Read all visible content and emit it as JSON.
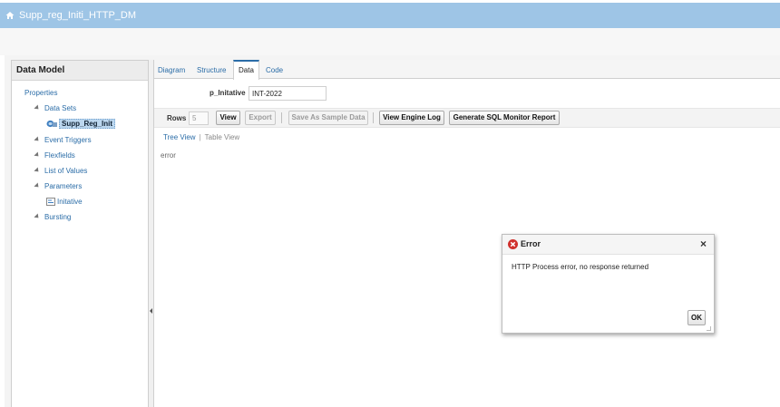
{
  "header": {
    "title": "Supp_reg_Initi_HTTP_DM",
    "home_icon": "home-icon"
  },
  "left_panel": {
    "title": "Data Model",
    "tree": [
      {
        "label": "Properties"
      },
      {
        "label": "Data Sets"
      },
      {
        "label": "Supp_Reg_Init"
      },
      {
        "label": "Event Triggers"
      },
      {
        "label": "Flexfields"
      },
      {
        "label": "List of Values"
      },
      {
        "label": "Parameters"
      },
      {
        "label": "Initative"
      },
      {
        "label": "Bursting"
      }
    ]
  },
  "tabs": [
    {
      "label": "Diagram"
    },
    {
      "label": "Structure"
    },
    {
      "label": "Data"
    },
    {
      "label": "Code"
    }
  ],
  "parameter": {
    "label": "p_Initative",
    "value": "INT-2022"
  },
  "toolbar": {
    "rows_label": "Rows",
    "rows_value": "5",
    "view": "View",
    "export": "Export",
    "save_sample": "Save As Sample Data",
    "view_log": "View Engine Log",
    "sql_report": "Generate SQL Monitor Report"
  },
  "subtabs": {
    "tree_view": "Tree View",
    "separator": "|",
    "table_view": "Table View"
  },
  "output": {
    "text": "error"
  },
  "dialog": {
    "title": "Error",
    "close": "×",
    "message": "HTTP Process error, no response returned",
    "ok": "OK"
  },
  "colors": {
    "header_bg": "#9ec5e6",
    "link": "#2a6ca7",
    "selection": "#bcd7ef",
    "error": "#d0312d"
  }
}
